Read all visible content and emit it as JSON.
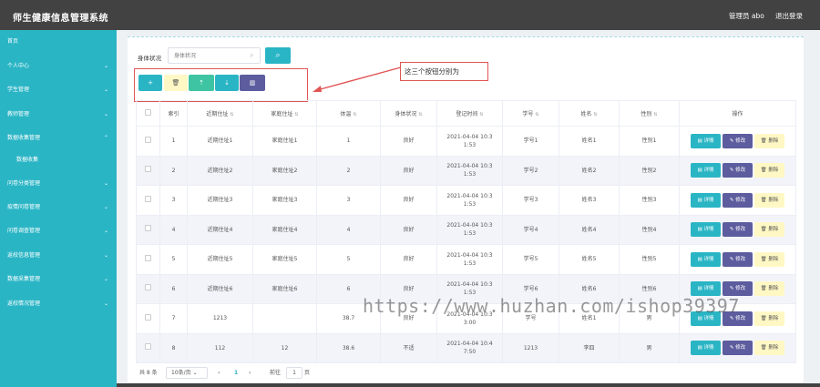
{
  "app": {
    "title": "师生健康信息管理系统",
    "admin_label": "管理员 abo",
    "logout": "退出登录"
  },
  "sidebar": {
    "items": [
      {
        "label": "首页",
        "arrow": ""
      },
      {
        "label": "个人中心",
        "arrow": "⌄"
      },
      {
        "label": "学生管理",
        "arrow": "⌄"
      },
      {
        "label": "教师管理",
        "arrow": "⌄"
      },
      {
        "label": "数据收集管理",
        "arrow": "⌃"
      },
      {
        "label": "数据收集",
        "arrow": ""
      },
      {
        "label": "问卷分类管理",
        "arrow": "⌄"
      },
      {
        "label": "疫情问卷管理",
        "arrow": "⌄"
      },
      {
        "label": "问卷调查管理",
        "arrow": "⌄"
      },
      {
        "label": "返校信息管理",
        "arrow": "⌄"
      },
      {
        "label": "数据采集管理",
        "arrow": "⌄"
      },
      {
        "label": "返校情况管理",
        "arrow": "⌄"
      }
    ]
  },
  "search": {
    "label": "身体状况",
    "placeholder": "身体状况",
    "icon": "search-icon",
    "button_icon": "search-icon"
  },
  "toolbar": {
    "add_icon": "+",
    "delete_icon": "🗑",
    "import_icon": "⇡",
    "export_icon": "⇣",
    "stat_icon": "▥"
  },
  "annotation": {
    "callout_text": "这三个按钮分别为"
  },
  "table": {
    "columns": [
      "索引",
      "近期住址",
      "家庭住址",
      "体温",
      "身体状况",
      "登记时间",
      "学号",
      "姓名",
      "性别",
      "操作"
    ],
    "rows": [
      {
        "index": "1",
        "recent": "近期住址1",
        "home": "家庭住址1",
        "temp": "1",
        "health": "良好",
        "time": "2021-04-04 10:3\n1:53",
        "sid": "学号1",
        "name": "姓名1",
        "gender": "性别1"
      },
      {
        "index": "2",
        "recent": "近期住址2",
        "home": "家庭住址2",
        "temp": "2",
        "health": "良好",
        "time": "2021-04-04 10:3\n1:53",
        "sid": "学号2",
        "name": "姓名2",
        "gender": "性别2"
      },
      {
        "index": "3",
        "recent": "近期住址3",
        "home": "家庭住址3",
        "temp": "3",
        "health": "良好",
        "time": "2021-04-04 10:3\n1:53",
        "sid": "学号3",
        "name": "姓名3",
        "gender": "性别3"
      },
      {
        "index": "4",
        "recent": "近期住址4",
        "home": "家庭住址4",
        "temp": "4",
        "health": "良好",
        "time": "2021-04-04 10:3\n1:53",
        "sid": "学号4",
        "name": "姓名4",
        "gender": "性别4"
      },
      {
        "index": "5",
        "recent": "近期住址5",
        "home": "家庭住址5",
        "temp": "5",
        "health": "良好",
        "time": "2021-04-04 10:3\n1:53",
        "sid": "学号5",
        "name": "姓名5",
        "gender": "性别5"
      },
      {
        "index": "6",
        "recent": "近期住址6",
        "home": "家庭住址6",
        "temp": "6",
        "health": "良好",
        "time": "2021-04-04 10:3\n1:53",
        "sid": "学号6",
        "name": "姓名6",
        "gender": "性别6"
      },
      {
        "index": "7",
        "recent": "1213",
        "home": "",
        "temp": "38.7",
        "health": "良好",
        "time": "2021-04-04 10:3\n3:00",
        "sid": "学号",
        "name": "姓名1",
        "gender": "男"
      },
      {
        "index": "8",
        "recent": "112",
        "home": "12",
        "temp": "38.6",
        "health": "不适",
        "time": "2021-04-04 10:4\n7:50",
        "sid": "1213",
        "name": "李四",
        "gender": "男"
      }
    ],
    "actions": {
      "detail": "详情",
      "edit": "修改",
      "delete": "删除"
    }
  },
  "pagination": {
    "total": "共 8 条",
    "page_size": "10条/页",
    "prev": "‹",
    "current": "1",
    "next": "›",
    "goto_label": "前往",
    "goto_value": "1",
    "goto_suffix": "页"
  },
  "watermark": "https://www.huzhan.com/ishop39397",
  "colors": {
    "accent": "#2ab5c5",
    "purple": "#5c5c9e",
    "header": "#424242",
    "annotation": "#e05555"
  }
}
